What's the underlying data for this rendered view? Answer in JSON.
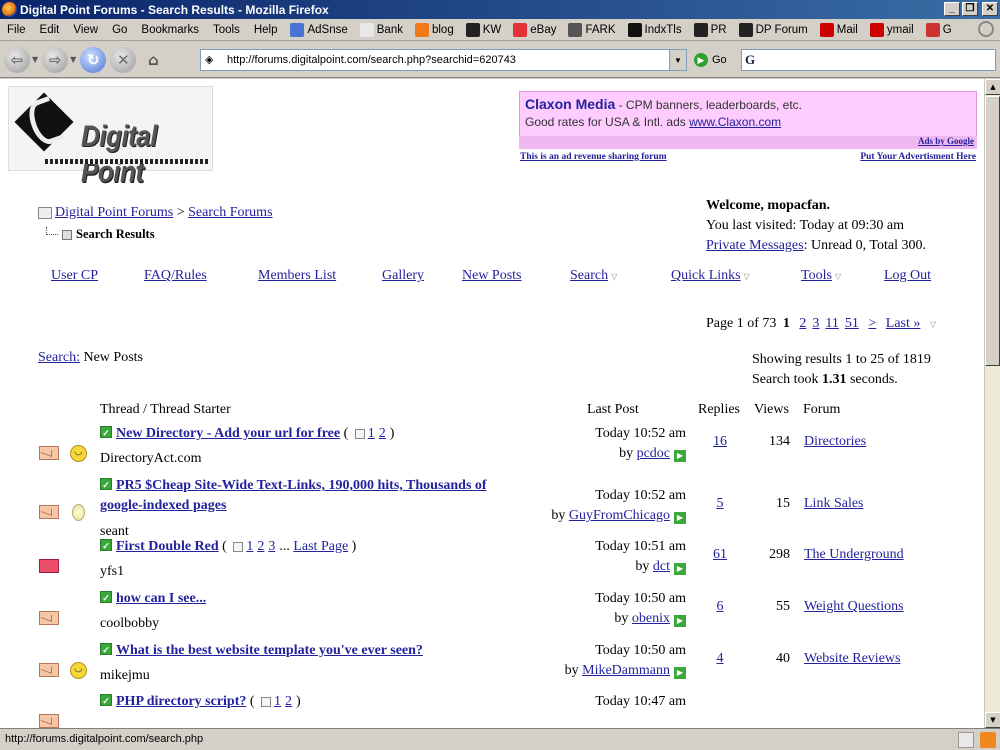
{
  "browser": {
    "title": "Digital Point Forums - Search Results - Mozilla Firefox",
    "menus": [
      "File",
      "Edit",
      "View",
      "Go",
      "Bookmarks",
      "Tools",
      "Help"
    ],
    "bookmarks": [
      {
        "label": "AdSnse",
        "icon": "google-icon",
        "color": "#4a74d4"
      },
      {
        "label": "Bank",
        "icon": "page-icon",
        "color": "#e8e8e8"
      },
      {
        "label": "blog",
        "icon": "blogger-icon",
        "color": "#f07a1a"
      },
      {
        "label": "KW",
        "icon": "diamond-icon",
        "color": "#222222"
      },
      {
        "label": "eBay",
        "icon": "ebay-icon",
        "color": "#e53238"
      },
      {
        "label": "FARK",
        "icon": "fark-icon",
        "color": "#555555"
      },
      {
        "label": "IndxTls",
        "icon": "info-icon",
        "color": "#111111"
      },
      {
        "label": "PR",
        "icon": "diamond-icon",
        "color": "#222222"
      },
      {
        "label": "DP Forum",
        "icon": "diamond-icon",
        "color": "#222222"
      },
      {
        "label": "Mail",
        "icon": "yahoo-icon",
        "color": "#cc0000"
      },
      {
        "label": "ymail",
        "icon": "yahoo-icon",
        "color": "#cc0000"
      },
      {
        "label": "G",
        "icon": "gmail-icon",
        "color": "#cc3333"
      }
    ],
    "url": "http://forums.digitalpoint.com/search.php?searchid=620743",
    "go_label": "Go",
    "search_engine_glyph": "G",
    "status_text": "http://forums.digitalpoint.com/search.php"
  },
  "logo": {
    "text": "Digital Point"
  },
  "ad": {
    "title": "Claxon Media",
    "tagline": " - CPM banners, leaderboards, etc.",
    "line2_prefix": "Good rates for USA & Intl. ads ",
    "line2_link": "www.Claxon.com",
    "ads_by": "Ads by Google",
    "note_left": "This is an ad revenue sharing forum",
    "note_right": "Put Your Advertisment Here"
  },
  "breadcrumb": {
    "forum": "Digital Point Forums",
    "sep": " > ",
    "section": "Search Forums",
    "current": "Search Results"
  },
  "welcome": {
    "greeting": "Welcome, mopacfan.",
    "last_visited": "You last visited: Today at 09:30 am",
    "pm_link": "Private Messages",
    "pm_status": ": Unread 0, Total 300."
  },
  "nav": {
    "user_cp": "User CP",
    "faq": "FAQ/Rules",
    "members": "Members List",
    "gallery": "Gallery",
    "new_posts": "New Posts",
    "search": "Search",
    "quick_links": "Quick Links",
    "tools": "Tools",
    "log_out": "Log Out"
  },
  "pagination": {
    "label": "Page 1 of 73",
    "current": "1",
    "pages": [
      "2",
      "3",
      "11",
      "51"
    ],
    "next": ">",
    "last": "Last »"
  },
  "search_label": {
    "link": "Search:",
    "text": " New Posts"
  },
  "results": {
    "showing": "Showing results 1 to 25 of 1819",
    "took_prefix": "Search took ",
    "took_value": "1.31",
    "took_suffix": " seconds."
  },
  "table": {
    "headers": {
      "thread": "Thread / Thread Starter",
      "last_post": "Last Post",
      "replies": "Replies",
      "views": "Views",
      "forum": "Forum"
    },
    "rows": [
      {
        "title": "New Directory - Add your url for free",
        "title2": "",
        "pages": [
          "1",
          "2"
        ],
        "starter": "DirectoryAct.com",
        "time": "Today 10:52 am",
        "by": "pcdoc",
        "replies": "16",
        "views": "134",
        "forum": "Directories",
        "icon": "smile"
      },
      {
        "title": "PR5 $Cheap Site-Wide Text-Links, 190,000 hits, Thousands of",
        "title2": "google-indexed pages",
        "pages": [],
        "starter": "seant",
        "time": "Today 10:52 am",
        "by": "GuyFromChicago",
        "replies": "5",
        "views": "15",
        "forum": "Link Sales",
        "icon": "bulb"
      },
      {
        "title": "First Double Red",
        "title2": "",
        "pages": [
          "1",
          "2",
          "3"
        ],
        "last_page": "Last Page",
        "starter": "yfs1",
        "time": "Today 10:51 am",
        "by": "dct",
        "replies": "61",
        "views": "298",
        "forum": "The Underground",
        "icon": "none"
      },
      {
        "title": "how can I see...",
        "title2": "",
        "pages": [],
        "starter": "coolbobby",
        "time": "Today 10:50 am",
        "by": "obenix",
        "replies": "6",
        "views": "55",
        "forum": "Weight Questions",
        "icon": "none"
      },
      {
        "title": "What is the best website template you've ever seen?",
        "title2": "",
        "pages": [],
        "starter": "mikejmu",
        "time": "Today 10:50 am",
        "by": "MikeDammann",
        "replies": "4",
        "views": "40",
        "forum": "Website Reviews",
        "icon": "smile"
      },
      {
        "title": "PHP directory script?",
        "title2": "",
        "pages": [
          "1",
          "2"
        ],
        "starter": "",
        "time": "Today 10:47 am",
        "by": "",
        "replies": "",
        "views": "",
        "forum": "",
        "icon": "none"
      }
    ]
  }
}
